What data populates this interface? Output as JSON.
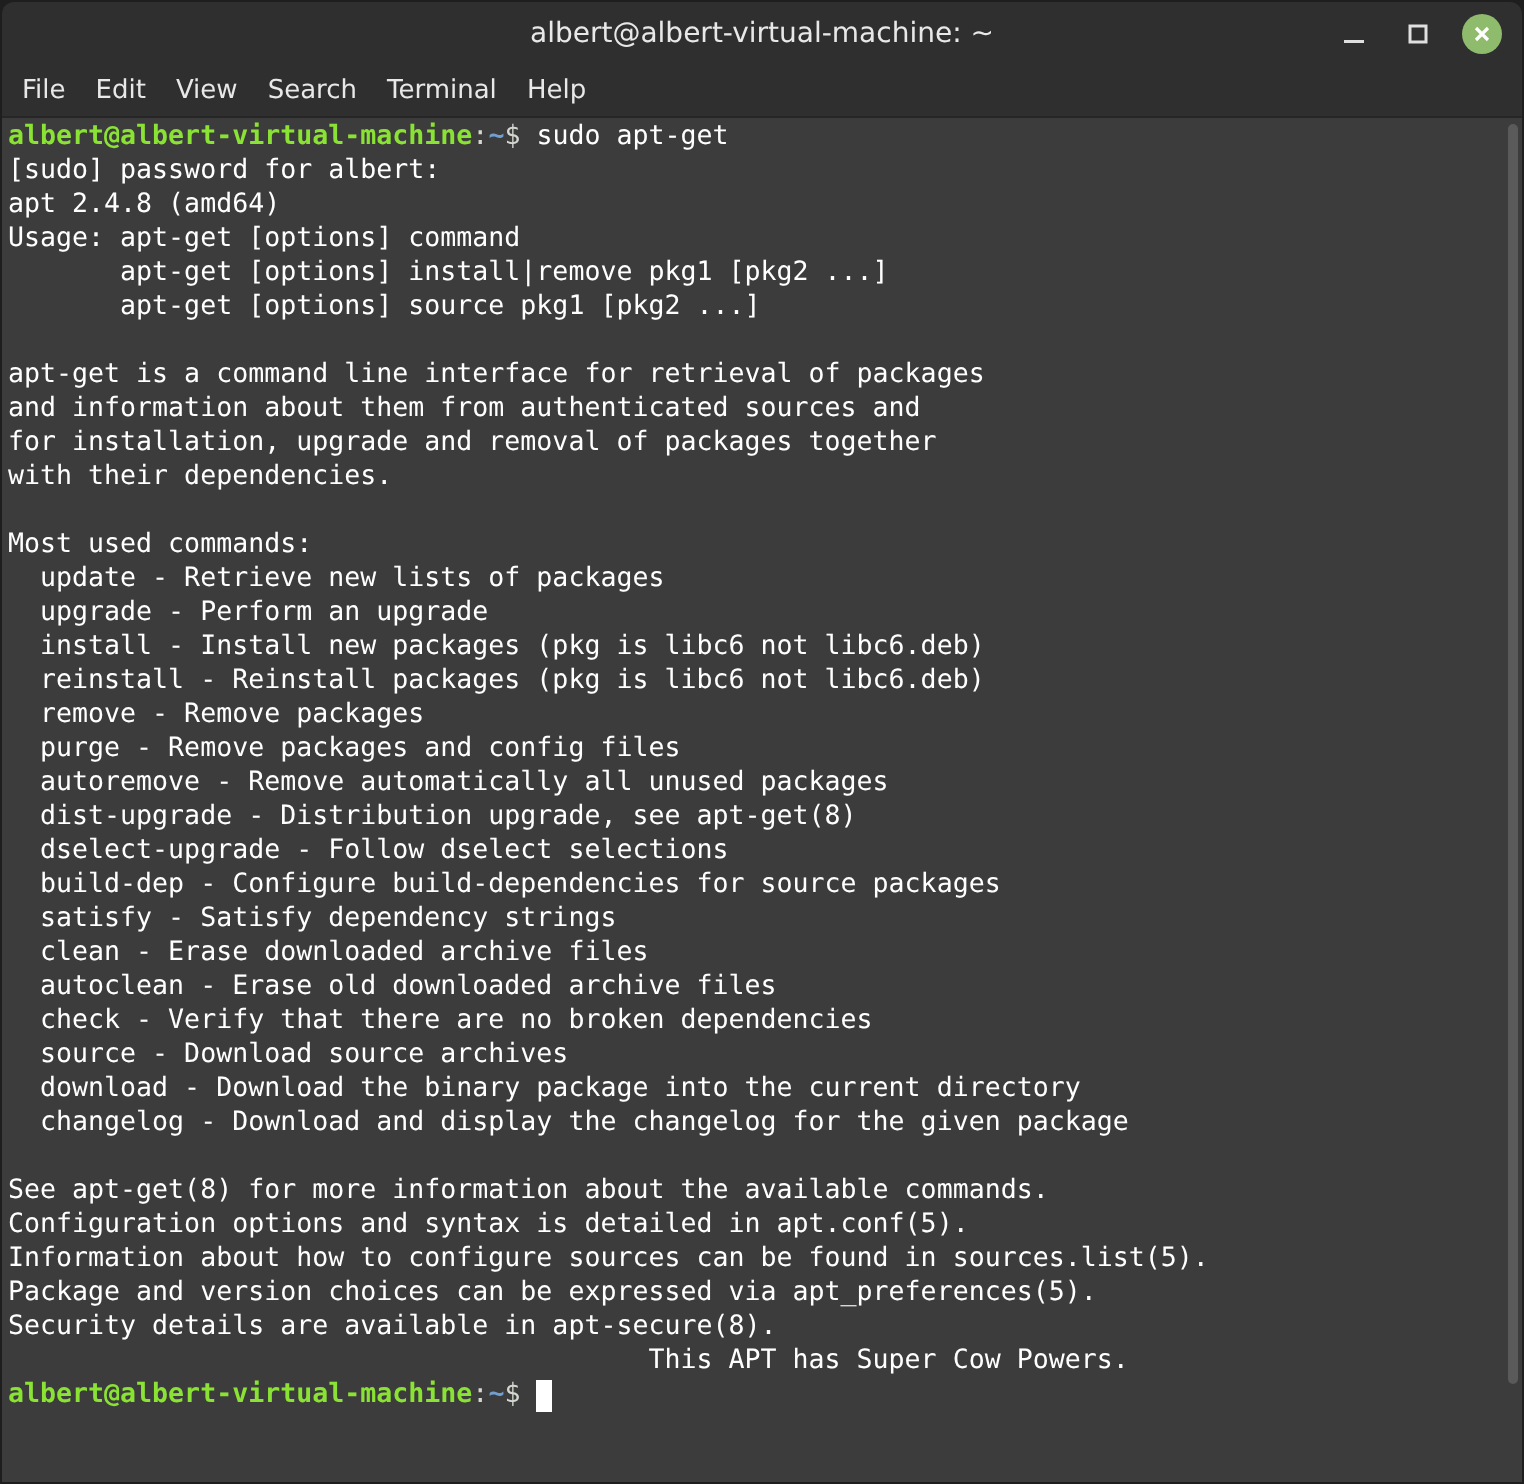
{
  "window": {
    "title": "albert@albert-virtual-machine: ~"
  },
  "menu": [
    "File",
    "Edit",
    "View",
    "Search",
    "Terminal",
    "Help"
  ],
  "lines": [
    {
      "kind": "prompt",
      "user_host": "albert@albert-virtual-machine",
      "separator": ":",
      "path": "~",
      "symbol": "$",
      "command": "sudo apt-get",
      "cursor": false
    },
    {
      "kind": "output",
      "text": "[sudo] password for albert:"
    },
    {
      "kind": "output",
      "text": "apt 2.4.8 (amd64)"
    },
    {
      "kind": "output",
      "text": "Usage: apt-get [options] command"
    },
    {
      "kind": "output",
      "text": "       apt-get [options] install|remove pkg1 [pkg2 ...]"
    },
    {
      "kind": "output",
      "text": "       apt-get [options] source pkg1 [pkg2 ...]"
    },
    {
      "kind": "blank"
    },
    {
      "kind": "output",
      "text": "apt-get is a command line interface for retrieval of packages"
    },
    {
      "kind": "output",
      "text": "and information about them from authenticated sources and"
    },
    {
      "kind": "output",
      "text": "for installation, upgrade and removal of packages together"
    },
    {
      "kind": "output",
      "text": "with their dependencies."
    },
    {
      "kind": "blank"
    },
    {
      "kind": "output",
      "text": "Most used commands:"
    },
    {
      "kind": "output",
      "text": "  update - Retrieve new lists of packages"
    },
    {
      "kind": "output",
      "text": "  upgrade - Perform an upgrade"
    },
    {
      "kind": "output",
      "text": "  install - Install new packages (pkg is libc6 not libc6.deb)"
    },
    {
      "kind": "output",
      "text": "  reinstall - Reinstall packages (pkg is libc6 not libc6.deb)"
    },
    {
      "kind": "output",
      "text": "  remove - Remove packages"
    },
    {
      "kind": "output",
      "text": "  purge - Remove packages and config files"
    },
    {
      "kind": "output",
      "text": "  autoremove - Remove automatically all unused packages"
    },
    {
      "kind": "output",
      "text": "  dist-upgrade - Distribution upgrade, see apt-get(8)"
    },
    {
      "kind": "output",
      "text": "  dselect-upgrade - Follow dselect selections"
    },
    {
      "kind": "output",
      "text": "  build-dep - Configure build-dependencies for source packages"
    },
    {
      "kind": "output",
      "text": "  satisfy - Satisfy dependency strings"
    },
    {
      "kind": "output",
      "text": "  clean - Erase downloaded archive files"
    },
    {
      "kind": "output",
      "text": "  autoclean - Erase old downloaded archive files"
    },
    {
      "kind": "output",
      "text": "  check - Verify that there are no broken dependencies"
    },
    {
      "kind": "output",
      "text": "  source - Download source archives"
    },
    {
      "kind": "output",
      "text": "  download - Download the binary package into the current directory"
    },
    {
      "kind": "output",
      "text": "  changelog - Download and display the changelog for the given package"
    },
    {
      "kind": "blank"
    },
    {
      "kind": "output",
      "text": "See apt-get(8) for more information about the available commands."
    },
    {
      "kind": "output",
      "text": "Configuration options and syntax is detailed in apt.conf(5)."
    },
    {
      "kind": "output",
      "text": "Information about how to configure sources can be found in sources.list(5)."
    },
    {
      "kind": "output",
      "text": "Package and version choices can be expressed via apt_preferences(5)."
    },
    {
      "kind": "output",
      "text": "Security details are available in apt-secure(8)."
    },
    {
      "kind": "output",
      "text": "                                        This APT has Super Cow Powers."
    },
    {
      "kind": "prompt",
      "user_host": "albert@albert-virtual-machine",
      "separator": ":",
      "path": "~",
      "symbol": "$",
      "cursor": true
    }
  ]
}
